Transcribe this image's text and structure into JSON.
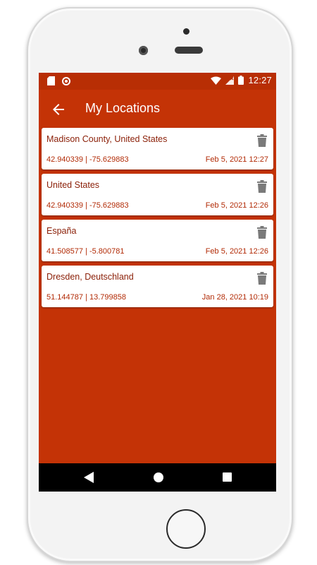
{
  "status_bar": {
    "time": "12:27",
    "icons": [
      "sd-card-icon",
      "record-icon",
      "wifi-icon",
      "no-signal-icon",
      "battery-icon"
    ]
  },
  "app_bar": {
    "title": "My Locations",
    "back_icon": "arrow-left-icon"
  },
  "locations": [
    {
      "name": "Madison County, United States",
      "coords": "42.940339 | -75.629883",
      "date": "Feb 5, 2021 12:27"
    },
    {
      "name": "United States",
      "coords": "42.940339 | -75.629883",
      "date": "Feb 5, 2021 12:26"
    },
    {
      "name": "España",
      "coords": "41.508577 | -5.800781",
      "date": "Feb 5, 2021 12:26"
    },
    {
      "name": "Dresden, Deutschland",
      "coords": "51.144787 | 13.799858",
      "date": "Jan 28, 2021 10:19"
    }
  ],
  "nav_bar": {
    "icons": [
      "nav-back-icon",
      "nav-home-icon",
      "nav-recents-icon"
    ]
  },
  "colors": {
    "primary": "#c43306",
    "status_bar": "#b82e04",
    "card_text": "#b22b06",
    "card_bg": "#ffffff",
    "trash": "#7a7a7a"
  }
}
